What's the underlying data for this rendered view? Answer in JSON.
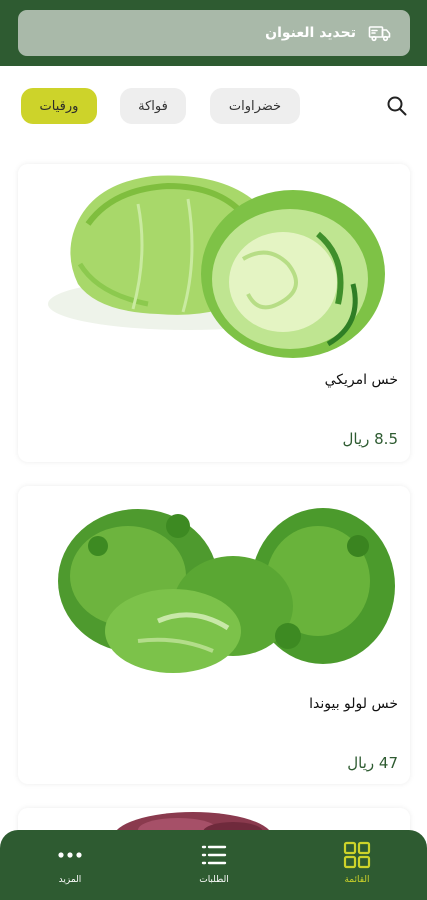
{
  "header": {
    "address_label": "تحديد العنوان",
    "address_icon": "delivery-truck-icon"
  },
  "filters": {
    "search_icon": "search-icon",
    "chips": [
      {
        "label": "ورقيات",
        "active": true
      },
      {
        "label": "فواكة",
        "active": false
      },
      {
        "label": "خضراوات",
        "active": false
      }
    ]
  },
  "products": [
    {
      "name": "خس امريكي",
      "price": "8.5 ريال"
    },
    {
      "name": "خس لولو بيوندا",
      "price": "47 ريال"
    }
  ],
  "bottom_nav": {
    "items": [
      {
        "label": "القائمة",
        "icon": "grid-icon",
        "active": true
      },
      {
        "label": "الطلبات",
        "icon": "list-icon",
        "active": false
      },
      {
        "label": "المزيد",
        "icon": "more-dots-icon",
        "active": false
      }
    ]
  },
  "colors": {
    "primary": "#2e5b31",
    "accent": "#cdd32a",
    "chip_bg": "#eeeeee"
  }
}
